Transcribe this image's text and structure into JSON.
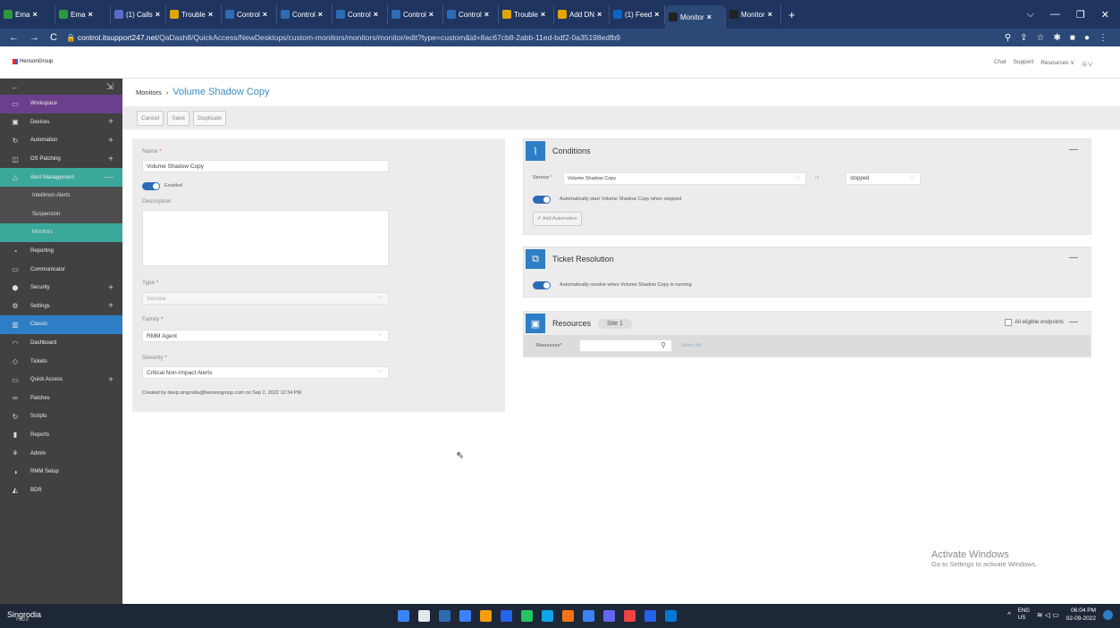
{
  "browser": {
    "tabs": [
      {
        "label": "Ema",
        "color": "#2c9a3c",
        "active": false
      },
      {
        "label": "Ema",
        "color": "#2c9a3c",
        "active": false
      },
      {
        "label": "(1) Calls",
        "color": "#5b6cc7",
        "active": false
      },
      {
        "label": "Trouble",
        "color": "#e2a600",
        "active": false
      },
      {
        "label": "Control",
        "color": "#2d6bb5",
        "active": false
      },
      {
        "label": "Control",
        "color": "#2d6bb5",
        "active": false
      },
      {
        "label": "Control",
        "color": "#2d6bb5",
        "active": false
      },
      {
        "label": "Control",
        "color": "#2d6bb5",
        "active": false
      },
      {
        "label": "Control",
        "color": "#2d6bb5",
        "active": false
      },
      {
        "label": "Trouble",
        "color": "#e2a600",
        "active": false
      },
      {
        "label": "Add DN",
        "color": "#e2a600",
        "active": false
      },
      {
        "label": "(1) Feed",
        "color": "#0a66c2",
        "active": false
      },
      {
        "label": "Monitor",
        "color": "#222222",
        "active": true
      },
      {
        "label": "Monitor",
        "color": "#222222",
        "active": false
      }
    ],
    "url_host": "control.itsupport247.net",
    "url_path": "/QaDash8/QuickAccess/NewDesktops/custom-monitors/monitors/monitor/edit?type=custom&id=8ac67cb8-2abb-11ed-bdf2-0a35198edfb9"
  },
  "header": {
    "logo": "HensonGroup",
    "links": [
      "Chat",
      "Support",
      "Resources ∨"
    ]
  },
  "sidebar": {
    "items": [
      {
        "label": "Workspace",
        "icon": "monitor-icon",
        "plus": false,
        "bg": "#6c3f8c",
        "sub": false
      },
      {
        "label": "Devices",
        "icon": "devices-icon",
        "plus": true,
        "bg": "",
        "sub": false
      },
      {
        "label": "Automation",
        "icon": "automation-icon",
        "plus": true,
        "bg": "",
        "sub": false
      },
      {
        "label": "OS Patching",
        "icon": "patching-icon",
        "plus": true,
        "bg": "",
        "sub": false
      },
      {
        "label": "Alert Management",
        "icon": "alert-icon",
        "plus": true,
        "bg": "#3aa89b",
        "sub": false
      },
      {
        "label": "Intellimon Alerts",
        "icon": "",
        "plus": false,
        "bg": "",
        "sub": true
      },
      {
        "label": "Suspension",
        "icon": "",
        "plus": false,
        "bg": "",
        "sub": true
      },
      {
        "label": "Monitors",
        "icon": "",
        "plus": false,
        "bg": "#3aa89b",
        "sub": true
      },
      {
        "label": "Reporting",
        "icon": "reporting-icon",
        "plus": false,
        "bg": "",
        "sub": false
      },
      {
        "label": "Communicator",
        "icon": "communicator-icon",
        "plus": false,
        "bg": "",
        "sub": false
      },
      {
        "label": "Security",
        "icon": "security-icon",
        "plus": true,
        "bg": "",
        "sub": false
      },
      {
        "label": "Settings",
        "icon": "settings-icon",
        "plus": true,
        "bg": "",
        "sub": false
      },
      {
        "label": "Classic",
        "icon": "classic-icon",
        "plus": false,
        "bg": "#2d7ec5",
        "sub": false
      },
      {
        "label": "Dashboard",
        "icon": "dashboard-icon",
        "plus": false,
        "bg": "",
        "sub": false
      },
      {
        "label": "Tickets",
        "icon": "tickets-icon",
        "plus": false,
        "bg": "",
        "sub": false
      },
      {
        "label": "Quick Access",
        "icon": "quick-access-icon",
        "plus": true,
        "bg": "",
        "sub": false
      },
      {
        "label": "Patches",
        "icon": "patches-icon",
        "plus": false,
        "bg": "",
        "sub": false
      },
      {
        "label": "Scripts",
        "icon": "scripts-icon",
        "plus": false,
        "bg": "",
        "sub": false
      },
      {
        "label": "Reports",
        "icon": "reports-icon",
        "plus": false,
        "bg": "",
        "sub": false
      },
      {
        "label": "Admin",
        "icon": "admin-icon",
        "plus": false,
        "bg": "",
        "sub": false
      },
      {
        "label": "RMM Setup",
        "icon": "rmm-setup-icon",
        "plus": false,
        "bg": "",
        "sub": false
      },
      {
        "label": "BDR",
        "icon": "bdr-icon",
        "plus": false,
        "bg": "",
        "sub": false
      }
    ]
  },
  "breadcrumb": {
    "parent": "Monitors",
    "separator": "›",
    "current": "Volume Shadow Copy"
  },
  "toolbar": {
    "cancel": "Cancel",
    "save": "Save",
    "duplicate": "Duplicate"
  },
  "form": {
    "name_label": "Name",
    "name_value": "Volume Shadow Copy",
    "enabled_label": "Enabled",
    "description_label": "Description",
    "type_label": "Type",
    "type_value": "Service",
    "family_label": "Family",
    "family_value": "RMM Agent",
    "severity_label": "Severity",
    "severity_value": "Critical Non-Impact Alerts",
    "created_by": "Created by deep.singrodia@hensongroup.com on Sep 2, 2022 12:34 PM"
  },
  "conditions": {
    "title": "Conditions",
    "service_label": "Service",
    "service_value": "Volume Shadow Copy",
    "is_label": "Is",
    "is_value": "stopped",
    "auto_start": "Automatically start Volume Shadow Copy when stopped",
    "add_automation": "Add Automation"
  },
  "ticket": {
    "title": "Ticket Resolution",
    "auto_resolve": "Automatically resolve when Volume Shadow Copy is running"
  },
  "resources": {
    "title": "Resources",
    "site_badge": "Site 1",
    "all_eligible": "All eligible endpoints",
    "resources_label": "Resources*",
    "select_all": "Select All"
  },
  "watermark": {
    "line1": "Activate Windows",
    "line2": "Go to Settings to activate Windows."
  },
  "taskbar": {
    "user": "Singrodia",
    "weather": "Haze",
    "lang1": "ENG",
    "lang2": "US",
    "time": "06:04 PM",
    "date": "02-09-2022",
    "apps": [
      "#3b82f6",
      "#e5e7eb",
      "#2b6cb0",
      "#3b82f6",
      "#f59e0b",
      "#2563eb",
      "#22c55e",
      "#0ea5e9",
      "#f97316",
      "#3b82f6",
      "#6366f1",
      "#ef4444",
      "#2563eb",
      "#0078d4"
    ]
  }
}
